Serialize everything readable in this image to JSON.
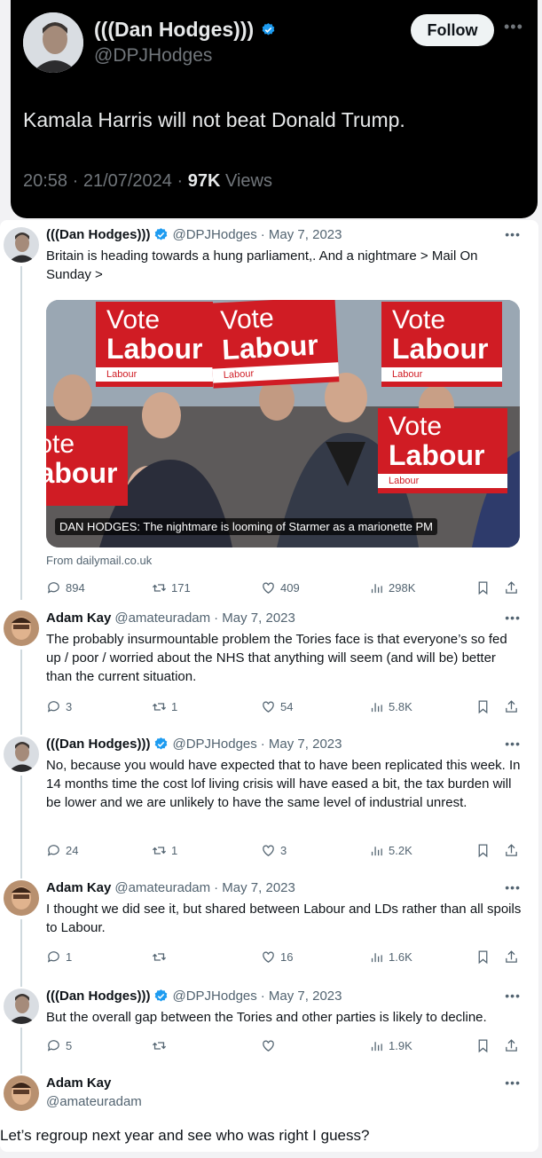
{
  "top_tweet": {
    "name": "(((Dan Hodges)))",
    "handle": "@DPJHodges",
    "follow_label": "Follow",
    "text": "Kamala Harris will not beat Donald Trump.",
    "time": "20:58 · 21/07/2024 · ",
    "views_count": "97K",
    "views_label": " Views"
  },
  "thread": [
    {
      "name": "(((Dan Hodges)))",
      "handle": "@DPJHodges",
      "date": "· May 7, 2023",
      "text": "Britain is heading towards a hung parliament,. And a nightmare > Mail On Sunday >",
      "card_caption": "DAN HODGES: The nightmare is looming of Starmer as a marionette PM",
      "card_from": "From dailymail.co.uk",
      "sign_vote": "Vote",
      "sign_labour": "Labour",
      "sign_small": "Labour",
      "replies": "894",
      "retweets": "171",
      "likes": "409",
      "views": "298K"
    },
    {
      "name": "Adam Kay",
      "handle": "@amateuradam",
      "date": "· May 7, 2023",
      "text": "The probably insurmountable problem the Tories face is that everyone’s so fed up / poor / worried about the NHS that anything will seem (and will be) better than the current situation.",
      "replies": "3",
      "retweets": "1",
      "likes": "54",
      "views": "5.8K"
    },
    {
      "name": "(((Dan Hodges)))",
      "handle": "@DPJHodges",
      "date": "· May 7, 2023",
      "text": "No, because you would have expected that to have been replicated this week. In 14 months time the cost lof living crisis will have eased a bit, the tax burden will be lower and we are unlikely to have the same level of industrial unrest.",
      "replies": "24",
      "retweets": "1",
      "likes": "3",
      "views": "5.2K"
    },
    {
      "name": "Adam Kay",
      "handle": "@amateuradam",
      "date": "· May 7, 2023",
      "text": "I thought we did see it, but shared between Labour and LDs rather than all spoils to Labour.",
      "replies": "1",
      "retweets": "",
      "likes": "16",
      "views": "1.6K"
    },
    {
      "name": "(((Dan Hodges)))",
      "handle": "@DPJHodges",
      "date": "· May 7, 2023",
      "text": "But the overall gap between the Tories and other parties is likely to decline.",
      "replies": "5",
      "retweets": "",
      "likes": "",
      "views": "1.9K"
    },
    {
      "name": "Adam Kay",
      "handle": "@amateuradam",
      "text": "Let’s regroup next year and see who was right I guess?"
    }
  ],
  "colors": {
    "accent": "#1d9bf0",
    "labour_red": "#d01c24",
    "dark_bg": "#000000"
  }
}
